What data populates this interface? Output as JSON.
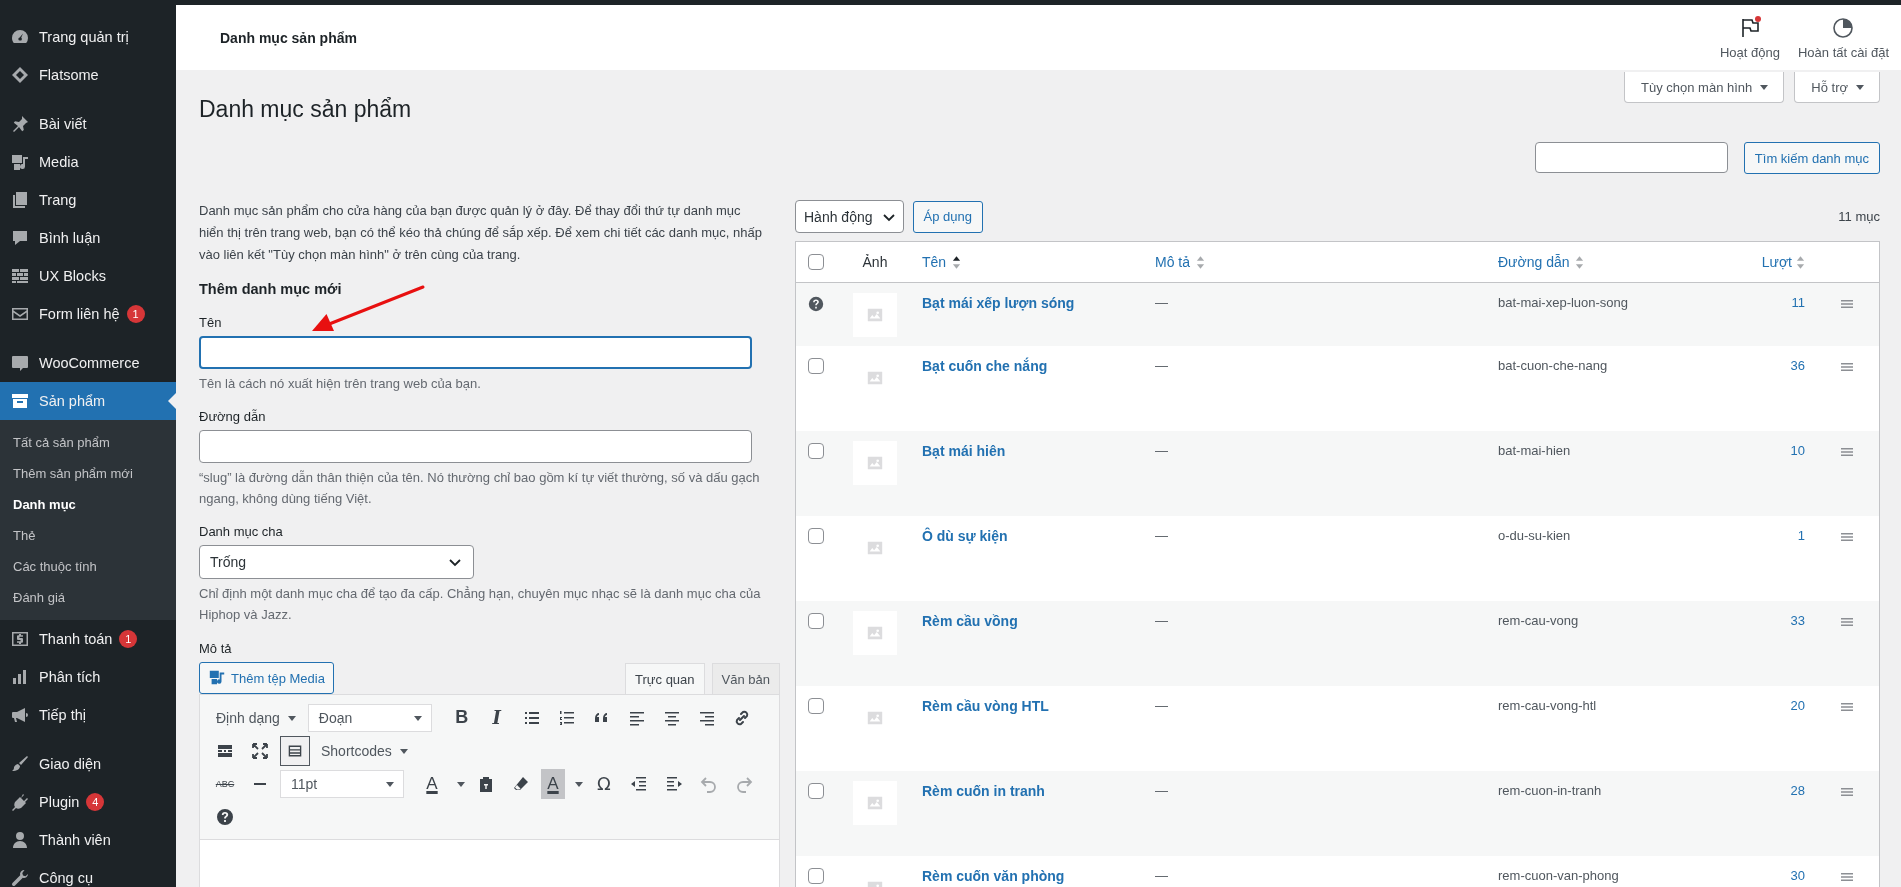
{
  "sidebar": {
    "groups": [
      [
        {
          "label": "Trang quản trị",
          "selected": false
        },
        {
          "label": "Flatsome",
          "selected": false
        }
      ],
      [
        {
          "label": "Bài viết",
          "selected": false
        },
        {
          "label": "Media",
          "selected": false
        },
        {
          "label": "Trang",
          "selected": false
        },
        {
          "label": "Bình luận",
          "selected": false
        },
        {
          "label": "UX Blocks",
          "selected": false
        },
        {
          "label": "Form liên hệ",
          "selected": false,
          "badge": "1"
        }
      ],
      [
        {
          "label": "WooCommerce",
          "selected": false
        },
        {
          "label": "Sản phẩm",
          "selected": true,
          "children": [
            {
              "label": "Tất cả sản phẩm",
              "selected": false
            },
            {
              "label": "Thêm sản phẩm mới",
              "selected": false
            },
            {
              "label": "Danh mục",
              "selected": true
            },
            {
              "label": "Thẻ",
              "selected": false
            },
            {
              "label": "Các thuộc tính",
              "selected": false
            },
            {
              "label": "Đánh giá",
              "selected": false
            }
          ]
        },
        {
          "label": "Thanh toán",
          "selected": false,
          "badge": "1"
        },
        {
          "label": "Phân tích",
          "selected": false
        },
        {
          "label": "Tiếp thị",
          "selected": false
        }
      ],
      [
        {
          "label": "Giao diện",
          "selected": false
        },
        {
          "label": "Plugin",
          "selected": false,
          "badge": "4"
        },
        {
          "label": "Thành viên",
          "selected": false
        },
        {
          "label": "Công cụ",
          "selected": false
        }
      ]
    ]
  },
  "header": {
    "title": "Danh mục sản phẩm",
    "actions": [
      {
        "label": "Hoạt động",
        "notification": true
      },
      {
        "label": "Hoàn tất cài đặt",
        "notification": false
      }
    ]
  },
  "screen_meta": [
    "Tùy chọn màn hình",
    "Hỗ trợ"
  ],
  "page_title": "Danh mục sản phẩm",
  "search_button": "Tìm kiếm danh mục",
  "form": {
    "intro": "Danh mục sản phẩm cho cửa hàng của bạn được quản lý ở đây. Để thay đổi thứ tự danh mục hiển thị trên trang web, bạn có thể kéo thả chúng để sắp xếp. Để xem chi tiết các danh mục, nhấp vào liên kết \"Tùy chọn màn hình\" ở trên cùng của trang.",
    "heading": "Thêm danh mục mới",
    "fields": [
      {
        "kind": "text",
        "label": "Tên",
        "focused": true,
        "hint": "Tên là cách nó xuất hiện trên trang web của bạn."
      },
      {
        "kind": "text",
        "label": "Đường dẫn",
        "focused": false,
        "hint": "“slug” là đường dẫn thân thiện của tên. Nó thường chỉ bao gồm kí tự viết thường, số và dấu gạch ngang, không dùng tiếng Việt."
      },
      {
        "kind": "select",
        "label": "Danh mục cha",
        "value": "Trống",
        "hint": "Chỉ định một danh mục cha để tạo đa cấp. Chẳng hạn, chuyên mục nhạc sẽ là danh mục cha của Hiphop và Jazz."
      }
    ],
    "editor": {
      "label": "Mô tả",
      "media_button": "Thêm tệp Media",
      "tabs": [
        {
          "label": "Trực quan",
          "selected": true
        },
        {
          "label": "Văn bản",
          "selected": false
        }
      ],
      "format_menu": "Định dạng",
      "block_format": "Đoạn",
      "bold": "B",
      "italic": "I",
      "shortcodes": "Shortcodes",
      "strikethrough": "ABC",
      "font_size": "11pt",
      "text_color": "A",
      "background_color": "A",
      "special_character": "Ω",
      "toolbar_toggle_on": true
    }
  },
  "table": {
    "bulk_action": "Hành động",
    "apply": "Áp dụng",
    "count": "11 mục",
    "select_all_checked": false,
    "columns": [
      {
        "label": "Ảnh",
        "sortable": false,
        "sorted": false
      },
      {
        "label": "Tên",
        "sortable": true,
        "sorted": true
      },
      {
        "label": "Mô tả",
        "sortable": true,
        "sorted": false
      },
      {
        "label": "Đường dẫn",
        "sortable": true,
        "sorted": false
      },
      {
        "label": "Lượt",
        "sortable": true,
        "sorted": false
      }
    ],
    "rows": [
      {
        "kind": "default",
        "name": "Bạt mái xếp lượn sóng",
        "description": "—",
        "slug": "bat-mai-xep-luon-song",
        "count": "11"
      },
      {
        "kind": "normal",
        "checked": false,
        "name": "Bạt cuốn che nắng",
        "description": "—",
        "slug": "bat-cuon-che-nang",
        "count": "36"
      },
      {
        "kind": "normal",
        "checked": false,
        "name": "Bạt mái hiên",
        "description": "—",
        "slug": "bat-mai-hien",
        "count": "10"
      },
      {
        "kind": "normal",
        "checked": false,
        "name": "Ô dù sự kiện",
        "description": "—",
        "slug": "o-du-su-kien",
        "count": "1"
      },
      {
        "kind": "normal",
        "checked": false,
        "name": "Rèm cầu vồng",
        "description": "—",
        "slug": "rem-cau-vong",
        "count": "33"
      },
      {
        "kind": "normal",
        "checked": false,
        "name": "Rèm cầu vòng HTL",
        "description": "—",
        "slug": "rem-cau-vong-htl",
        "count": "20"
      },
      {
        "kind": "normal",
        "checked": false,
        "name": "Rèm cuốn in tranh",
        "description": "—",
        "slug": "rem-cuon-in-tranh",
        "count": "28"
      },
      {
        "kind": "normal",
        "checked": false,
        "name": "Rèm cuốn văn phòng",
        "description": "—",
        "slug": "rem-cuon-van-phong",
        "count": "30"
      }
    ]
  }
}
